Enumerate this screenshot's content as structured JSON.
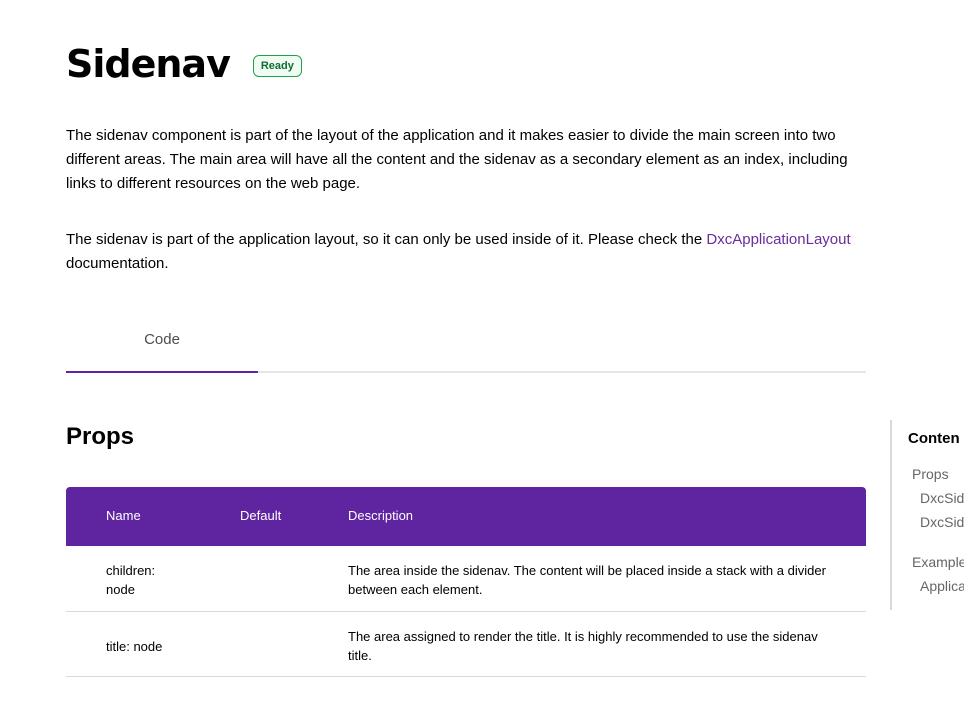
{
  "header": {
    "title": "Sidenav",
    "status": "Ready"
  },
  "intro": {
    "paragraph1": "The sidenav component is part of the layout of the application and it makes easier to divide the main screen into two different areas. The main area will have all the content and the sidenav as a secondary element as an index, including links to different resources on the web page.",
    "paragraph2_before": "The sidenav is part of the application layout, so it can only be used inside of it. Please check the ",
    "paragraph2_link": "DxcApplicationLayout",
    "paragraph2_after": " documentation."
  },
  "tabs": [
    {
      "label": "Code",
      "active": true
    }
  ],
  "props": {
    "section_title": "Props",
    "columns": [
      "Name",
      "Default",
      "Description"
    ],
    "rows": [
      {
        "name": "children: node",
        "name_line1": "children:",
        "name_line2": "node",
        "default": "",
        "description": "The area inside the sidenav. The content will be placed inside a stack with a divider between each element."
      },
      {
        "name": "title: node",
        "default": "",
        "description": "The area assigned to render the title. It is highly recommended to use the sidenav title."
      }
    ]
  },
  "toc": {
    "title": "Conten",
    "items": [
      {
        "label": "Props",
        "level": 1
      },
      {
        "label": "DxcSid",
        "level": 2
      },
      {
        "label": "DxcSid",
        "level": 2
      },
      {
        "label": "Example",
        "level": 1
      },
      {
        "label": "Applica",
        "level": 2
      }
    ]
  },
  "colors": {
    "accent": "#5f249f",
    "link": "#6a2c9e",
    "badge_border": "#24a148",
    "badge_text": "#0f6d31"
  }
}
